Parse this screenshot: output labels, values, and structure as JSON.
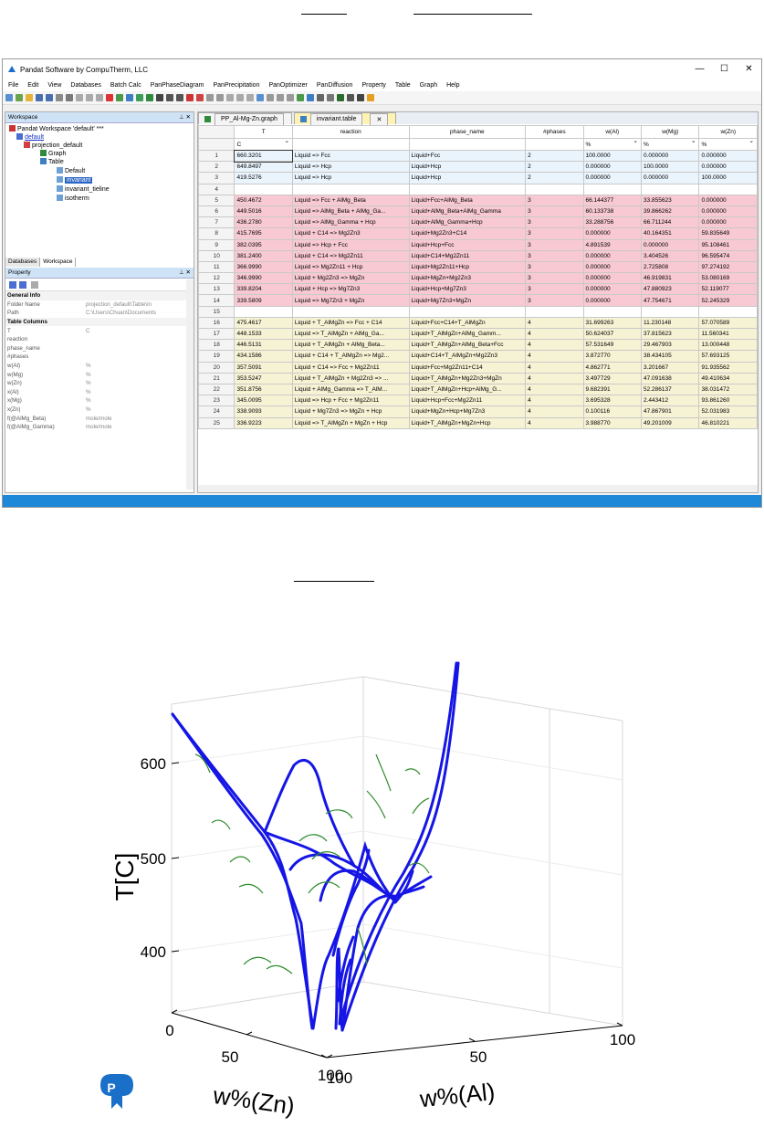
{
  "window": {
    "title": "Pandat Software by CompuTherm, LLC",
    "minimize": "—",
    "maximize": "☐",
    "close": "✕"
  },
  "menu": [
    "File",
    "Edit",
    "View",
    "Databases",
    "Batch Calc",
    "PanPhaseDiagram",
    "PanPrecipitation",
    "PanOptimizer",
    "PanDiffusion",
    "Property",
    "Table",
    "Graph",
    "Help"
  ],
  "workspace": {
    "header": "Workspace",
    "pin": "⊥ ✕",
    "tree": {
      "root": "Pandat Workspace 'default' ***",
      "default": "default",
      "projection": "projection_default",
      "graph": "Graph",
      "table": "Table",
      "default_table": "Default",
      "invariant": "invariant",
      "invariant_tieline": "invariant_tieline",
      "isotherm": "isotherm"
    },
    "tabs": [
      "Databases",
      "Workspace"
    ]
  },
  "property": {
    "header": "Property",
    "rows": [
      {
        "k": "General Info",
        "v": "",
        "section": true
      },
      {
        "k": "Folder Name",
        "v": "projection_default\\Table\\in"
      },
      {
        "k": "Path",
        "v": "C:\\Users\\Chuan\\Documents"
      },
      {
        "k": "Table Columns",
        "v": "",
        "section": true
      },
      {
        "k": "T",
        "v": "C"
      },
      {
        "k": "reaction",
        "v": ""
      },
      {
        "k": "phase_name",
        "v": ""
      },
      {
        "k": "#phases",
        "v": ""
      },
      {
        "k": "w(Al)",
        "v": "%"
      },
      {
        "k": "w(Mg)",
        "v": "%"
      },
      {
        "k": "w(Zn)",
        "v": "%"
      },
      {
        "k": "x(Al)",
        "v": "%"
      },
      {
        "k": "x(Mg)",
        "v": "%"
      },
      {
        "k": "x(Zn)",
        "v": "%"
      },
      {
        "k": "f(@AlMg_Beta)",
        "v": "mole/mole"
      },
      {
        "k": "f(@AlMg_Gamma)",
        "v": "mole/mole"
      }
    ]
  },
  "doc_tabs": [
    "PP_Al-Mg-Zn.graph",
    "invariant.table"
  ],
  "table": {
    "headers": [
      "T",
      "reaction",
      "phase_name",
      "#phases",
      "w(Al)",
      "w(Mg)",
      "w(Zn)"
    ],
    "units": [
      "C",
      "",
      "",
      "",
      "%",
      "%",
      "%"
    ],
    "rows": [
      {
        "n": "1",
        "T": "660.3201",
        "r": "Liquid => Fcc",
        "p": "Liquid+Fcc",
        "np": "2",
        "al": "100.0000",
        "mg": "0.000000",
        "zn": "0.000000",
        "g": "g2"
      },
      {
        "n": "2",
        "T": "649.8497",
        "r": "Liquid => Hcp",
        "p": "Liquid+Hcp",
        "np": "2",
        "al": "0.000000",
        "mg": "100.0000",
        "zn": "0.000000",
        "g": "g2"
      },
      {
        "n": "3",
        "T": "419.5276",
        "r": "Liquid => Hcp",
        "p": "Liquid+Hcp",
        "np": "2",
        "al": "0.000000",
        "mg": "0.000000",
        "zn": "100.0000",
        "g": "g2"
      },
      {
        "n": "4",
        "T": "",
        "r": "",
        "p": "",
        "np": "",
        "al": "",
        "mg": "",
        "zn": "",
        "g": ""
      },
      {
        "n": "5",
        "T": "450.4672",
        "r": "Liquid => Fcc + AlMg_Beta",
        "p": "Liquid+Fcc+AlMg_Beta",
        "np": "3",
        "al": "66.144377",
        "mg": "33.855623",
        "zn": "0.000000",
        "g": "g3"
      },
      {
        "n": "6",
        "T": "449.5016",
        "r": "Liquid => AlMg_Beta + AlMg_Ga...",
        "p": "Liquid+AlMg_Beta+AlMg_Gamma",
        "np": "3",
        "al": "60.133738",
        "mg": "39.866262",
        "zn": "0.000000",
        "g": "g3"
      },
      {
        "n": "7",
        "T": "436.2780",
        "r": "Liquid => AlMg_Gamma + Hcp",
        "p": "Liquid+AlMg_Gamma+Hcp",
        "np": "3",
        "al": "33.288756",
        "mg": "66.711244",
        "zn": "0.000000",
        "g": "g3"
      },
      {
        "n": "8",
        "T": "415.7695",
        "r": "Liquid + C14 => Mg2Zn3",
        "p": "Liquid+Mg2Zn3+C14",
        "np": "3",
        "al": "0.000000",
        "mg": "40.164351",
        "zn": "59.835649",
        "g": "g3"
      },
      {
        "n": "9",
        "T": "382.0395",
        "r": "Liquid => Hcp + Fcc",
        "p": "Liquid+Hcp+Fcc",
        "np": "3",
        "al": "4.891539",
        "mg": "0.000000",
        "zn": "95.108461",
        "g": "g3"
      },
      {
        "n": "10",
        "T": "381.2400",
        "r": "Liquid + C14 => Mg2Zn11",
        "p": "Liquid+C14+Mg2Zn11",
        "np": "3",
        "al": "0.000000",
        "mg": "3.404526",
        "zn": "96.595474",
        "g": "g3"
      },
      {
        "n": "11",
        "T": "366.9990",
        "r": "Liquid => Mg2Zn11 + Hcp",
        "p": "Liquid+Mg2Zn11+Hcp",
        "np": "3",
        "al": "0.000000",
        "mg": "2.725808",
        "zn": "97.274192",
        "g": "g3"
      },
      {
        "n": "12",
        "T": "346.9990",
        "r": "Liquid + Mg2Zn3 => MgZn",
        "p": "Liquid+MgZn+Mg2Zn3",
        "np": "3",
        "al": "0.000000",
        "mg": "46.919831",
        "zn": "53.080169",
        "g": "g3"
      },
      {
        "n": "13",
        "T": "339.8204",
        "r": "Liquid + Hcp => Mg7Zn3",
        "p": "Liquid+Hcp+Mg7Zn3",
        "np": "3",
        "al": "0.000000",
        "mg": "47.880923",
        "zn": "52.119077",
        "g": "g3"
      },
      {
        "n": "14",
        "T": "339.5809",
        "r": "Liquid => Mg7Zn3 + MgZn",
        "p": "Liquid+Mg7Zn3+MgZn",
        "np": "3",
        "al": "0.000000",
        "mg": "47.754671",
        "zn": "52.245329",
        "g": "g3"
      },
      {
        "n": "15",
        "T": "",
        "r": "",
        "p": "",
        "np": "",
        "al": "",
        "mg": "",
        "zn": "",
        "g": ""
      },
      {
        "n": "16",
        "T": "475.4617",
        "r": "Liquid + T_AlMgZn => Fcc + C14",
        "p": "Liquid+Fcc+C14+T_AlMgZn",
        "np": "4",
        "al": "31.699263",
        "mg": "11.230148",
        "zn": "57.070589",
        "g": "g4"
      },
      {
        "n": "17",
        "T": "448.1533",
        "r": "Liquid => T_AlMgZn + AlMg_Ga...",
        "p": "Liquid+T_AlMgZn+AlMg_Gamm...",
        "np": "4",
        "al": "50.624037",
        "mg": "37.815623",
        "zn": "11.560341",
        "g": "g4"
      },
      {
        "n": "18",
        "T": "446.5131",
        "r": "Liquid + T_AlMgZn + AlMg_Beta...",
        "p": "Liquid+T_AlMgZn+AlMg_Beta+Fcc",
        "np": "4",
        "al": "57.531649",
        "mg": "29.467903",
        "zn": "13.000448",
        "g": "g4"
      },
      {
        "n": "19",
        "T": "434.1586",
        "r": "Liquid + C14 + T_AlMgZn => Mg2...",
        "p": "Liquid+C14+T_AlMgZn+Mg2Zn3",
        "np": "4",
        "al": "3.872770",
        "mg": "38.434105",
        "zn": "57.693125",
        "g": "g4"
      },
      {
        "n": "20",
        "T": "357.5091",
        "r": "Liquid + C14 => Fcc + Mg2Zn11",
        "p": "Liquid+Fcc+Mg2Zn11+C14",
        "np": "4",
        "al": "4.862771",
        "mg": "3.201667",
        "zn": "91.935562",
        "g": "g4"
      },
      {
        "n": "21",
        "T": "353.5247",
        "r": "Liquid + T_AlMgZn + Mg2Zn3 => ...",
        "p": "Liquid+T_AlMgZn+Mg2Zn3+MgZn",
        "np": "4",
        "al": "3.497729",
        "mg": "47.091638",
        "zn": "49.410634",
        "g": "g4"
      },
      {
        "n": "22",
        "T": "351.8756",
        "r": "Liquid + AlMg_Gamma => T_AlM...",
        "p": "Liquid+T_AlMgZn+Hcp+AlMg_G...",
        "np": "4",
        "al": "9.682391",
        "mg": "52.286137",
        "zn": "38.031472",
        "g": "g4"
      },
      {
        "n": "23",
        "T": "345.0095",
        "r": "Liquid => Hcp + Fcc + Mg2Zn11",
        "p": "Liquid+Hcp+Fcc+Mg2Zn11",
        "np": "4",
        "al": "3.695328",
        "mg": "2.443412",
        "zn": "93.861260",
        "g": "g4"
      },
      {
        "n": "24",
        "T": "338.9093",
        "r": "Liquid + Mg7Zn3 => MgZn + Hcp",
        "p": "Liquid+MgZn+Hcp+Mg7Zn3",
        "np": "4",
        "al": "0.100116",
        "mg": "47.867901",
        "zn": "52.031983",
        "g": "g4"
      },
      {
        "n": "25",
        "T": "336.9223",
        "r": "Liquid => T_AlMgZn + MgZn + Hcp",
        "p": "Liquid+T_AlMgZn+MgZn+Hcp",
        "np": "4",
        "al": "3.988770",
        "mg": "49.201009",
        "zn": "46.810221",
        "g": "g4"
      }
    ]
  },
  "plot": {
    "ylabel": "T[C]",
    "yticks": [
      "600",
      "500",
      "400"
    ],
    "zn_label": "w%(Zn)",
    "zn_ticks": [
      "0",
      "50",
      "100"
    ],
    "al_label": "w%(Al)",
    "al_ticks": [
      "100",
      "50",
      "100"
    ],
    "colors": {
      "boundary": "#1515e6",
      "tieline": "#2e8b2e",
      "logo": "#1a70c8"
    }
  }
}
